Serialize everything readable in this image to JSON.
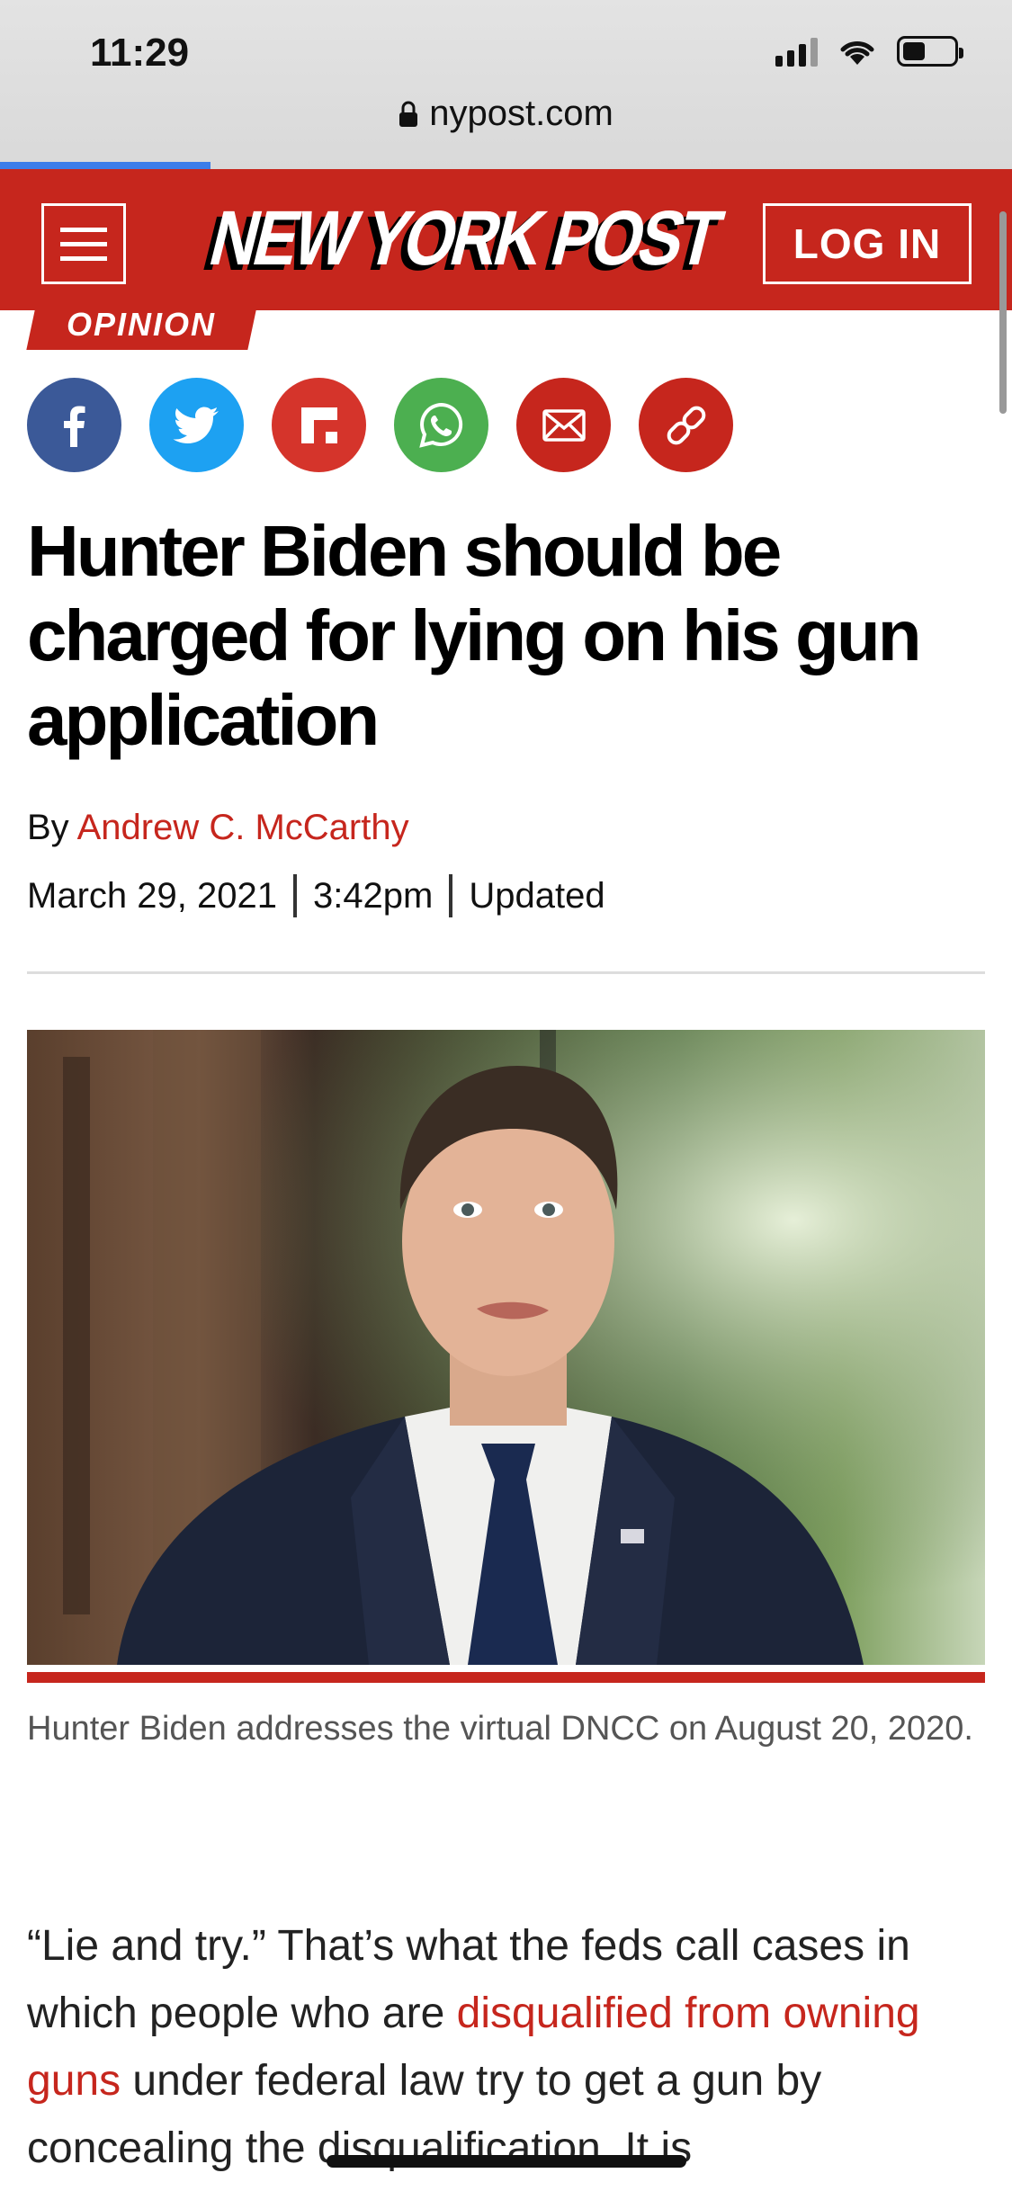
{
  "status_bar": {
    "time": "11:29"
  },
  "browser": {
    "url": "nypost.com",
    "load_progress": 0.32
  },
  "header": {
    "logo_text": "NEW YORK POST",
    "login_label": "LOG IN"
  },
  "article": {
    "section": "OPINION",
    "share_icons": [
      "facebook-icon",
      "twitter-icon",
      "flipboard-icon",
      "whatsapp-icon",
      "email-icon",
      "link-icon"
    ],
    "headline": "Hunter Biden should be charged for lying on his gun application",
    "by_prefix": "By",
    "author": "Andrew C. McCarthy",
    "date": "March 29, 2021",
    "time": "3:42pm",
    "updated_label": "Updated",
    "caption": "Hunter Biden addresses the virtual DNCC on August 20, 2020.",
    "body_start": "“Lie and try.” That’s what the feds call cases in which people who are ",
    "body_link": "disqualified from owning guns",
    "body_end": " under federal law try to get a gun by concealing the disqualification. It is"
  },
  "colors": {
    "brand_red": "#c6261d",
    "facebook": "#3b5998",
    "twitter": "#1da1f2",
    "whatsapp": "#4caf50"
  }
}
